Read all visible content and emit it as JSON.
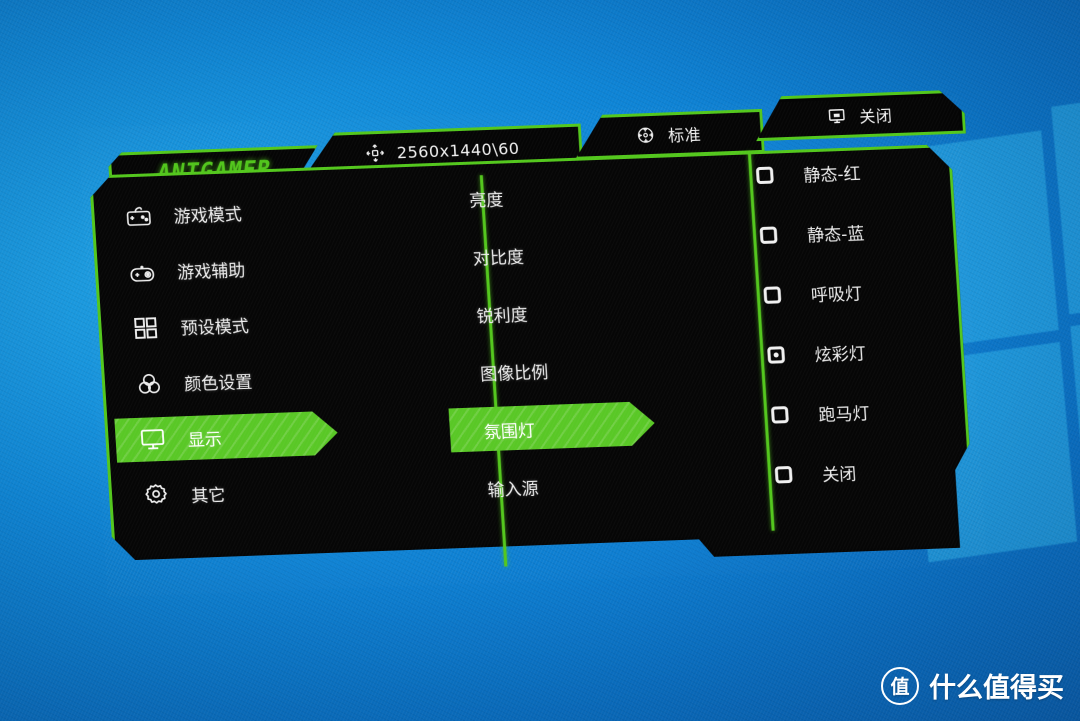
{
  "wallpaper": {
    "background_color": "#0c82d6",
    "logo": "windows-logo"
  },
  "osd": {
    "brand": "ANTGAMER",
    "accent_color": "#57c523",
    "panel_color": "#050505",
    "topbar": [
      {
        "icon": "resolution-icon",
        "label": "2560x1440\\60"
      },
      {
        "icon": "crosshair-icon",
        "label": "标准"
      },
      {
        "icon": "monitor-icon",
        "label": "关闭"
      }
    ],
    "left_menu": [
      {
        "icon": "gamepad-mode-icon",
        "label": "游戏模式",
        "selected": false
      },
      {
        "icon": "gamepad-assist-icon",
        "label": "游戏辅助",
        "selected": false
      },
      {
        "icon": "grid-icon",
        "label": "预设模式",
        "selected": false
      },
      {
        "icon": "color-circles-icon",
        "label": "颜色设置",
        "selected": false
      },
      {
        "icon": "monitor-icon",
        "label": "显示",
        "selected": true
      },
      {
        "icon": "gear-icon",
        "label": "其它",
        "selected": false
      }
    ],
    "middle_menu": [
      {
        "label": "亮度",
        "selected": false
      },
      {
        "label": "对比度",
        "selected": false
      },
      {
        "label": "锐利度",
        "selected": false
      },
      {
        "label": "图像比例",
        "selected": false
      },
      {
        "label": "氛围灯",
        "selected": true
      },
      {
        "label": "输入源",
        "selected": false
      }
    ],
    "right_options": [
      {
        "label": "静态-红",
        "selected": false
      },
      {
        "label": "静态-蓝",
        "selected": false
      },
      {
        "label": "呼吸灯",
        "selected": false
      },
      {
        "label": "炫彩灯",
        "selected": true
      },
      {
        "label": "跑马灯",
        "selected": false
      },
      {
        "label": "关闭",
        "selected": false
      }
    ]
  },
  "watermark": {
    "badge": "值",
    "text": "什么值得买"
  }
}
